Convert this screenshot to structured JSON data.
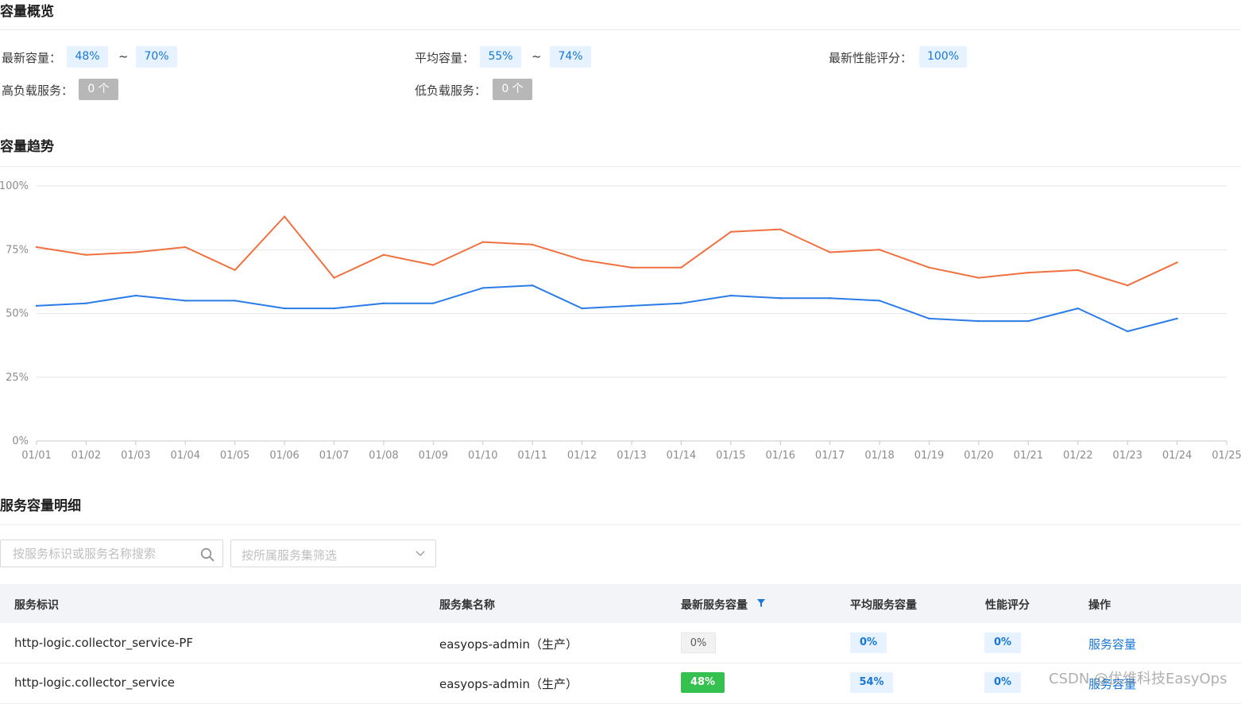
{
  "overview": {
    "title": "容量概览",
    "latest_capacity_label": "最新容量：",
    "latest_capacity_min": "48%",
    "latest_capacity_max": "70%",
    "avg_capacity_label": "平均容量：",
    "avg_capacity_min": "55%",
    "avg_capacity_max": "74%",
    "perf_score_label": "最新性能评分：",
    "perf_score_value": "100%",
    "high_load_label": "高负载服务：",
    "high_load_value": "0 个",
    "low_load_label": "低负载服务：",
    "low_load_value": "0 个",
    "range_separator": "~"
  },
  "trend": {
    "title": "容量趋势"
  },
  "chart_data": {
    "type": "line",
    "x": [
      "01/01",
      "01/02",
      "01/03",
      "01/04",
      "01/05",
      "01/06",
      "01/07",
      "01/08",
      "01/09",
      "01/10",
      "01/11",
      "01/12",
      "01/13",
      "01/14",
      "01/15",
      "01/16",
      "01/17",
      "01/18",
      "01/19",
      "01/20",
      "01/21",
      "01/22",
      "01/23",
      "01/24",
      "01/25"
    ],
    "ylim": [
      0,
      100
    ],
    "yticks": [
      "0%",
      "25%",
      "50%",
      "75%",
      "100%"
    ],
    "grid": true,
    "series": [
      {
        "color": "#f0703f",
        "values": [
          76,
          73,
          74,
          76,
          67,
          88,
          64,
          73,
          69,
          78,
          77,
          71,
          68,
          68,
          82,
          83,
          74,
          75,
          68,
          64,
          66,
          67,
          61,
          70
        ]
      },
      {
        "color": "#2b7ce9",
        "values": [
          53,
          54,
          57,
          55,
          55,
          52,
          52,
          54,
          54,
          60,
          61,
          52,
          53,
          54,
          57,
          56,
          56,
          55,
          48,
          47,
          47,
          52,
          43,
          48
        ]
      }
    ]
  },
  "detail": {
    "title": "服务容量明细",
    "search_placeholder": "按服务标识或服务名称搜索",
    "filter_placeholder": "按所属服务集筛选",
    "columns": {
      "service_id": "服务标识",
      "service_set": "服务集名称",
      "latest_capacity": "最新服务容量",
      "avg_capacity": "平均服务容量",
      "perf_score": "性能评分",
      "actions": "操作"
    },
    "rows": [
      {
        "service_id": "http-logic.collector_service-PF",
        "service_set": "easyops-admin（生产）",
        "latest": "0%",
        "avg": "0%",
        "score": "0%",
        "action": "服务容量"
      },
      {
        "service_id": "http-logic.collector_service",
        "service_set": "easyops-admin（生产）",
        "latest": "48%",
        "avg": "54%",
        "score": "0%",
        "action": "服务容量"
      }
    ]
  },
  "watermark": "CSDN @优维科技EasyOps"
}
